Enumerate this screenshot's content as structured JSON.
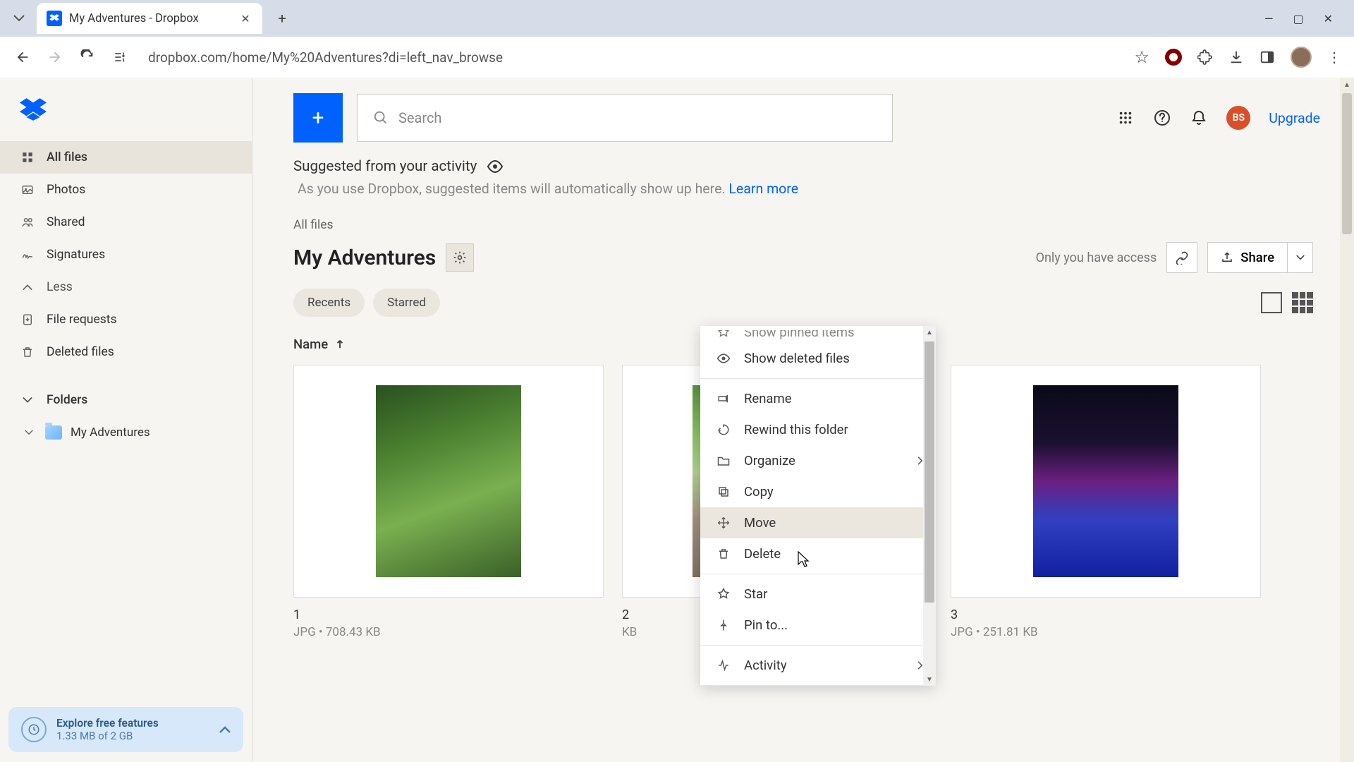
{
  "browser": {
    "tab_title": "My Adventures - Dropbox",
    "url": "dropbox.com/home/My%20Adventures?di=left_nav_browse"
  },
  "sidebar": {
    "items": [
      {
        "label": "All files"
      },
      {
        "label": "Photos"
      },
      {
        "label": "Shared"
      },
      {
        "label": "Signatures"
      }
    ],
    "less": "Less",
    "extra": [
      {
        "label": "File requests"
      },
      {
        "label": "Deleted files"
      }
    ],
    "folders_label": "Folders",
    "folder_name": "My Adventures",
    "storage": {
      "title": "Explore free features",
      "sub": "1.33 MB of 2 GB"
    }
  },
  "topbar": {
    "search_placeholder": "Search",
    "avatar_initials": "BS",
    "upgrade": "Upgrade"
  },
  "main": {
    "suggested_title": "Suggested from your activity",
    "suggested_sub_a": "As you use Dropbox, suggested items will automatically show up here. ",
    "suggested_sub_link": "Learn more",
    "breadcrumb": "All files",
    "folder_title": "My Adventures",
    "access": "Only you have access",
    "share": "Share",
    "filters": [
      "Recents",
      "Starred"
    ],
    "sort_col": "Name",
    "files": [
      {
        "name": "1",
        "meta": "JPG • 708.43 KB"
      },
      {
        "name": "2",
        "meta": "KB"
      },
      {
        "name": "3",
        "meta": "JPG • 251.81 KB"
      }
    ]
  },
  "context_menu": {
    "truncated_top": "Show pinned items",
    "items_a": [
      "Show deleted files"
    ],
    "items_b": [
      "Rename",
      "Rewind this folder",
      "Organize",
      "Copy",
      "Move",
      "Delete"
    ],
    "items_c": [
      "Star",
      "Pin to..."
    ],
    "items_d": [
      "Activity"
    ]
  }
}
